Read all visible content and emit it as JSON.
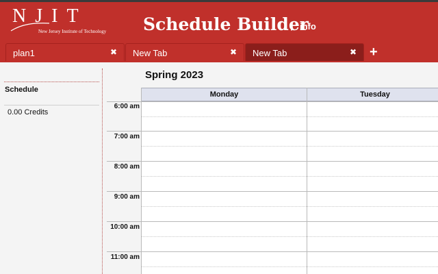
{
  "app": {
    "logo_letters": "NJIT",
    "logo_subtitle": "New Jersey Institute of Technology",
    "title": "Schedule Builder",
    "separator": "|",
    "info_link": "info",
    "brand_color": "#c0302b"
  },
  "tabs": [
    {
      "label": "plan1",
      "close": "✖",
      "active": false
    },
    {
      "label": "New Tab",
      "close": "✖",
      "active": false
    },
    {
      "label": "New Tab",
      "close": "✖",
      "active": true
    }
  ],
  "add_tab": "+",
  "sidebar": {
    "heading": "Schedule",
    "credits": "0.00 Credits"
  },
  "calendar": {
    "semester": "Spring 2023",
    "days": [
      "Monday",
      "Tuesday"
    ],
    "times": [
      "6:00 am",
      "7:00 am",
      "8:00 am",
      "9:00 am",
      "10:00 am",
      "11:00 am"
    ]
  }
}
